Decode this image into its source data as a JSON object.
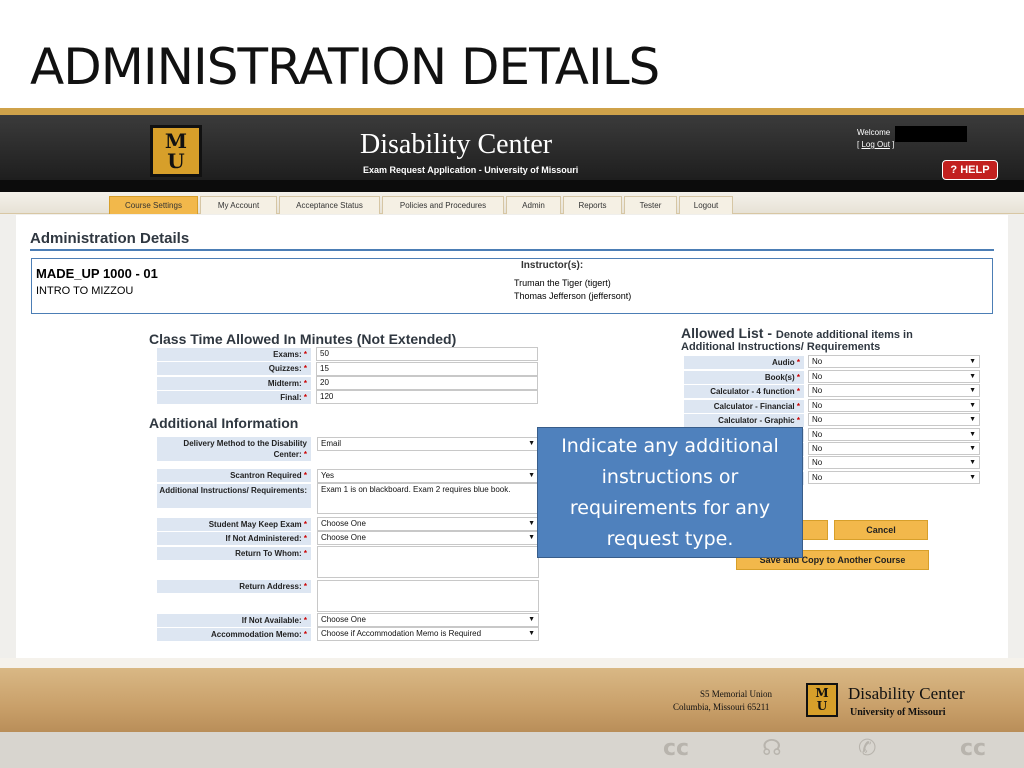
{
  "slide": {
    "title": "ADMINISTRATION DETAILS"
  },
  "header": {
    "logo_text": "M\nU",
    "title": "Disability Center",
    "subtitle": "Exam Request Application - University of Missouri",
    "welcome_label": "Welcome",
    "logout_label": "Log Out",
    "help_label": "HELP",
    "help_icon": "question-icon"
  },
  "nav": {
    "tabs": [
      {
        "label": "Course Settings",
        "active": true
      },
      {
        "label": "My Account",
        "active": false
      },
      {
        "label": "Acceptance Status",
        "active": false
      },
      {
        "label": "Policies and Procedures",
        "active": false
      },
      {
        "label": "Admin",
        "active": false
      },
      {
        "label": "Reports",
        "active": false
      },
      {
        "label": "Tester",
        "active": false
      },
      {
        "label": "Logout",
        "active": false
      }
    ]
  },
  "page": {
    "heading": "Administration Details",
    "course_code": "MADE_UP 1000 - 01",
    "course_name": "INTRO TO MIZZOU",
    "instructors_label": "Instructor(s):",
    "instructors": [
      "Truman the Tiger (tigert)",
      "Thomas Jefferson (jeffersont)"
    ]
  },
  "class_time": {
    "heading": "Class Time Allowed In Minutes (Not Extended)",
    "fields": [
      {
        "label": "Exams:",
        "value": "50"
      },
      {
        "label": "Quizzes:",
        "value": "15"
      },
      {
        "label": "Midterm:",
        "value": "20"
      },
      {
        "label": "Final:",
        "value": "120"
      }
    ]
  },
  "additional": {
    "heading": "Additional Information",
    "delivery_label": "Delivery Method to the Disability Center:",
    "delivery_value": "Email",
    "scantron_label": "Scantron Required",
    "scantron_value": "Yes",
    "instructions_label": "Additional Instructions/ Requirements:",
    "instructions_value": "Exam 1 is on blackboard.  Exam 2 requires blue book.",
    "keep_label": "Student May Keep Exam",
    "keep_value": "Choose One",
    "not_admin_label": "If Not Administered:",
    "not_admin_value": "Choose One",
    "return_whom_label": "Return To Whom:",
    "return_address_label": "Return Address:",
    "not_available_label": "If Not Available:",
    "not_available_value": "Choose One",
    "memo_label": "Accommodation Memo:",
    "memo_value": "Choose if Accommodation Memo is Required",
    "required_mark": "*"
  },
  "allowed": {
    "heading_main": "Allowed List - ",
    "heading_sub": "Denote additional items in",
    "heading_sub2": "Additional Instructions/ Requirements",
    "items": [
      {
        "label": "Audio",
        "value": "No"
      },
      {
        "label": "Book(s)",
        "value": "No"
      },
      {
        "label": "Calculator - 4 function",
        "value": "No"
      },
      {
        "label": "Calculator - Financial",
        "value": "No"
      },
      {
        "label": "Calculator - Graphic",
        "value": "No"
      },
      {
        "label": "",
        "value": "No"
      },
      {
        "label": "",
        "value": "No"
      },
      {
        "label": "",
        "value": "No"
      },
      {
        "label": "",
        "value": "No"
      }
    ],
    "cancel_label": "Cancel",
    "save_copy_label": "Save and Copy to Another Course"
  },
  "callout": {
    "text": "Indicate any additional instructions or requirements for any request type."
  },
  "footer": {
    "address_1": "S5 Memorial Union",
    "address_2": "Columbia, Missouri 65211",
    "org": "Disability Center",
    "university": "University of Missouri",
    "glyph_1": "cc",
    "glyph_2": "cc"
  },
  "colors": {
    "accent_gold": "#d79f2a",
    "tab_orange": "#f2b84b",
    "link_blue": "#4c7eb5",
    "callout_blue": "#4f81bd",
    "help_red": "#c2201f"
  }
}
